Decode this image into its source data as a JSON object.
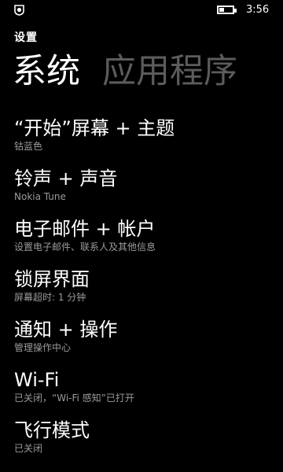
{
  "status": {
    "time": "3:56",
    "left_icon": "notification-shield-icon",
    "battery_icon": "battery-icon",
    "battery_level": 0.35
  },
  "header": {
    "app_title": "设置",
    "tabs": [
      {
        "label": "系统",
        "active": true
      },
      {
        "label": "应用程序",
        "active": false
      }
    ]
  },
  "settings": [
    {
      "title": "“开始”屏幕 + 主题",
      "subtitle": "钴蓝色"
    },
    {
      "title": "铃声 + 声音",
      "subtitle": "Nokia Tune"
    },
    {
      "title": "电子邮件 + 帐户",
      "subtitle": "设置电子邮件、联系人及其他信息"
    },
    {
      "title": "锁屏界面",
      "subtitle": "屏幕超时: 1 分钟"
    },
    {
      "title": "通知 + 操作",
      "subtitle": "管理操作中心"
    },
    {
      "title": "Wi-Fi",
      "subtitle": "已关闭，“Wi-Fi 感知”已打开"
    },
    {
      "title": "飞行模式",
      "subtitle": "已关闭"
    }
  ],
  "colors": {
    "background": "#000000",
    "text": "#ffffff",
    "subtitle": "#9a9a9a",
    "inactive_tab": "#5c5c5c"
  }
}
